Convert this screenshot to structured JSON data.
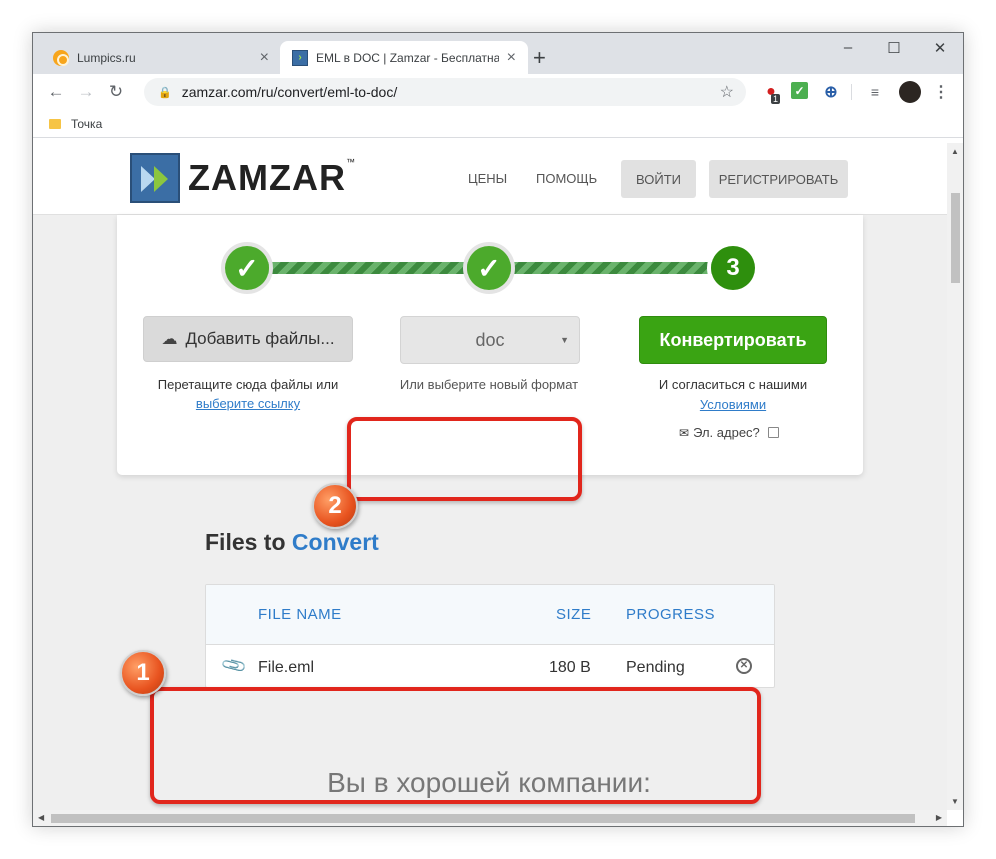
{
  "browser": {
    "tabs": [
      {
        "title": "Lumpics.ru",
        "active": false,
        "favicon": "lumpics-orange-icon"
      },
      {
        "title": "EML в DOC | Zamzar - Бесплатна",
        "active": true,
        "favicon": "zamzar-icon"
      }
    ],
    "window_controls": {
      "minimize": "–",
      "maximize": "☐",
      "close": "✕"
    },
    "address": "zamzar.com/ru/convert/eml-to-doc/",
    "bookmark": "Точка",
    "extension_badge": "1"
  },
  "site": {
    "logo_text": "ZAMZAR",
    "logo_tm": "™",
    "nav": {
      "prices": "ЦЕНЫ",
      "help": "ПОМОЩЬ",
      "login": "ВОЙТИ",
      "register": "РЕГИСТРИРОВАТЬ"
    }
  },
  "steps": {
    "step1": "✓",
    "step2": "✓",
    "step3": "3"
  },
  "upload": {
    "button": "Добавить файлы...",
    "drop_text": "Перетащите сюда файлы или",
    "drop_link": "выберите ссылку"
  },
  "format": {
    "selected": "doc",
    "hint": "Или выберите новый формат"
  },
  "convert": {
    "button": "Конвертировать",
    "agree_text": "И согласиться с нашими",
    "agree_link": "Условиями",
    "email_label": "Эл. адрес?"
  },
  "files": {
    "title_part1": "Files to",
    "title_part2": "Convert",
    "headers": {
      "name": "FILE NAME",
      "size": "SIZE",
      "progress": "PROGRESS"
    },
    "rows": [
      {
        "name": "File.eml",
        "size": "180 B",
        "progress": "Pending"
      }
    ]
  },
  "company_heading": "Вы в хорошей компании:",
  "annotations": {
    "marker1": "1",
    "marker2": "2"
  },
  "colors": {
    "brand_green": "#3aa413",
    "link_blue": "#2f7cc9",
    "annotation_red": "#e1261c",
    "marker_orange": "#e8531f"
  }
}
